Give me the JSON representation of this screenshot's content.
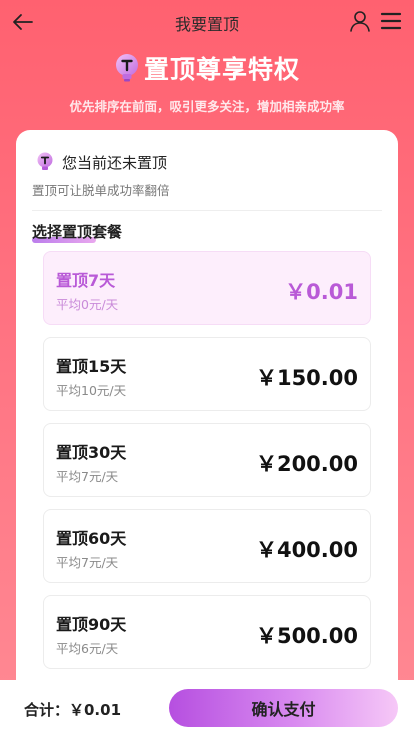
{
  "header": {
    "title": "我要置顶",
    "icons": {
      "back": "arrow-left-icon",
      "user": "user-icon",
      "menu": "hamburger-menu-icon"
    }
  },
  "hero": {
    "title": "置顶尊享特权",
    "subtitle": "优先排序在前面，吸引更多关注，增加相亲成功率"
  },
  "status": {
    "text": "您当前还未置顶",
    "description": "置顶可让脱单成功率翻倍"
  },
  "section": {
    "title": "选择置顶套餐"
  },
  "plans": [
    {
      "name": "置顶7天",
      "avg": "平均0元/天",
      "price": "￥0.01",
      "selected": true
    },
    {
      "name": "置顶15天",
      "avg": "平均10元/天",
      "price": "￥150.00",
      "selected": false
    },
    {
      "name": "置顶30天",
      "avg": "平均7元/天",
      "price": "￥200.00",
      "selected": false
    },
    {
      "name": "置顶60天",
      "avg": "平均7元/天",
      "price": "￥400.00",
      "selected": false
    },
    {
      "name": "置顶90天",
      "avg": "平均6元/天",
      "price": "￥500.00",
      "selected": false
    }
  ],
  "footer": {
    "total_label": "合计：￥0.01",
    "pay_label": "确认支付"
  },
  "colors": {
    "background": "#ff6b79",
    "accent": "#b95ad7",
    "selected_bg": "#fdeefc"
  }
}
